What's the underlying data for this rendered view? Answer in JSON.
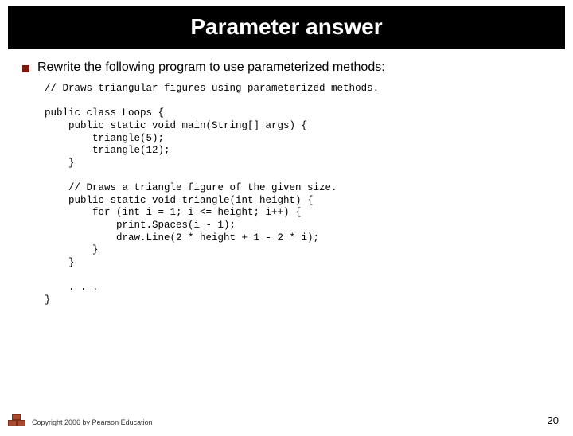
{
  "title": "Parameter answer",
  "prompt": "Rewrite the following program to use parameterized methods:",
  "code": "// Draws triangular figures using parameterized methods.\n\npublic class Loops {\n    public static void main(String[] args) {\n        triangle(5);\n        triangle(12);\n    }\n\n    // Draws a triangle figure of the given size.\n    public static void triangle(int height) {\n        for (int i = 1; i <= height; i++) {\n            print.Spaces(i - 1);\n            draw.Line(2 * height + 1 - 2 * i);\n        }\n    }\n\n    . . .\n}",
  "copyright": "Copyright 2006 by Pearson Education",
  "page_number": "20"
}
